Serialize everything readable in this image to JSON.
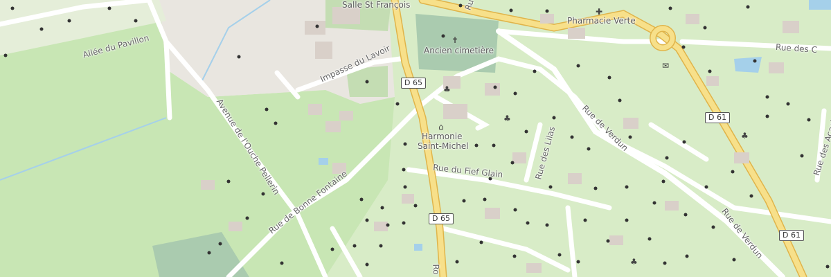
{
  "map": {
    "colors": {
      "background": "#f2efe9",
      "residential": "#e0dfdf",
      "garden": "#d8ecc7",
      "park": "#c8e6b4",
      "cemetery": "#aacbaf",
      "road_main": "#f7e08a",
      "road_main_casing": "#e0b44a",
      "road_minor": "#ffffff",
      "water": "#a5d0ea",
      "building": "#d9d0c9"
    },
    "streets": {
      "allee_pavillon": "Allée du Pavillon",
      "impasse_lavoir": "Impasse du Lavoir",
      "avenue_ouche": "Avenue de l'Ouche Pellerin",
      "rue_bonne_fontaine": "Rue de Bonne Fontaine",
      "rue_fief_glain": "Rue du Fief Glain",
      "rue_lilas": "Rue des Lilas",
      "rue_verdun_1": "Rue de Verdun",
      "rue_verdun_2": "Rue de Verdun",
      "rue_acacias": "Rue des Acacias",
      "rue_partial": "Rue des C",
      "rue_top": "Ru",
      "d65_bottom_partial": "Ro"
    },
    "pois": {
      "salle": "Salle St François",
      "cemetery": "Ancien cimetière",
      "pharmacy": "Pharmacie Verte",
      "harmonie_line1": "Harmonie",
      "harmonie_line2": "Saint-Michel"
    },
    "road_refs": {
      "d65_a": "D 65",
      "d65_b": "D 65",
      "d61_a": "D 61",
      "d61_b": "D 61"
    },
    "icons": {
      "tree": "tree-icon",
      "garden": "garden-flower-icon",
      "cemetery": "cemetery-icon",
      "pharmacy": "pharmacy-icon",
      "music": "music-hall-icon",
      "post": "post-office-icon"
    }
  }
}
